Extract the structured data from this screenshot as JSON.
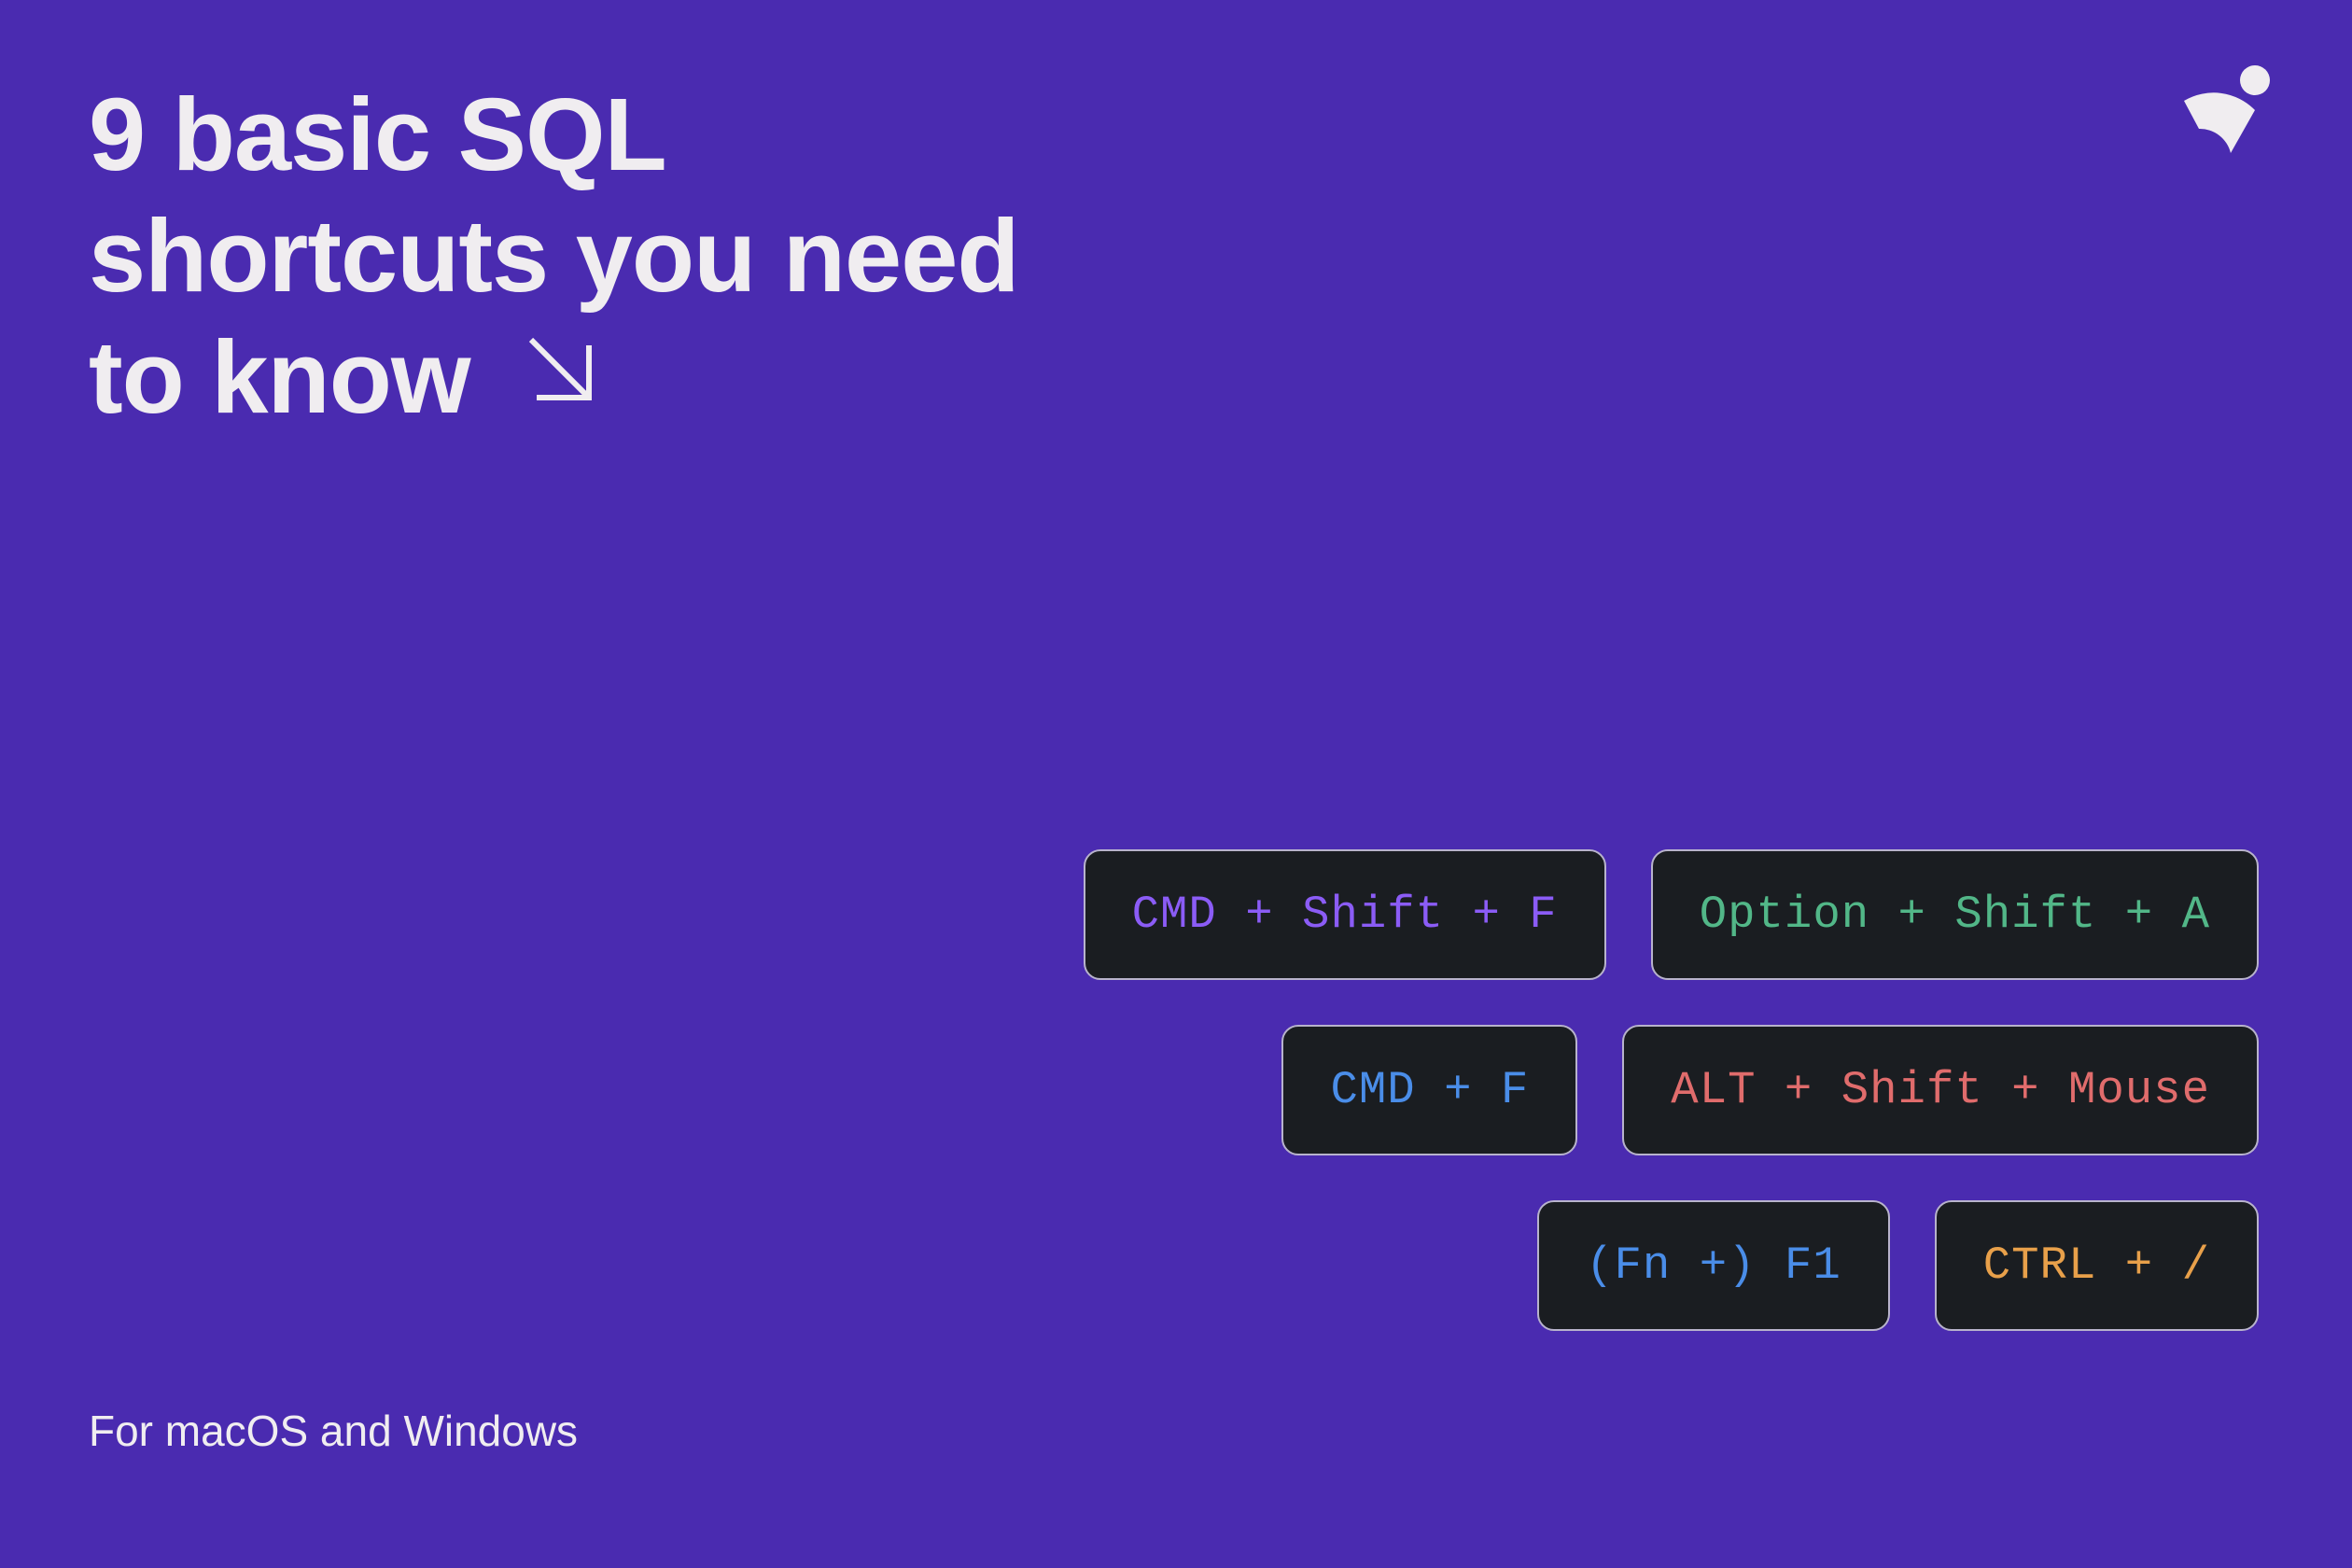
{
  "title": {
    "line1": "9 basic SQL",
    "line2": "shortcuts you need",
    "line3": "to know"
  },
  "subtitle": "For macOS and Windows",
  "shortcuts": {
    "row1": {
      "chip1": {
        "text": "CMD + Shift + F",
        "color": "purple"
      },
      "chip2": {
        "text": "Option + Shift + A",
        "color": "teal"
      }
    },
    "row2": {
      "chip1": {
        "text": "CMD + F",
        "color": "blue"
      },
      "chip2": {
        "text": "ALT + Shift + Mouse",
        "color": "red"
      }
    },
    "row3": {
      "chip1": {
        "text": "(Fn +) F1",
        "color": "blue"
      },
      "chip2": {
        "text": "CTRL + /",
        "color": "orange"
      }
    }
  },
  "icons": {
    "arrow": "arrow-down-right",
    "logo": "brand-logo"
  },
  "colors": {
    "background": "#4a2bb0",
    "foreground": "#f0edf0",
    "chipBg": "#1a1d21",
    "chipBorder": "#b8b3cc",
    "purple": "#8b5cf6",
    "teal": "#52b788",
    "blue": "#4a8de8",
    "red": "#e06c6c",
    "orange": "#e8a04a"
  }
}
